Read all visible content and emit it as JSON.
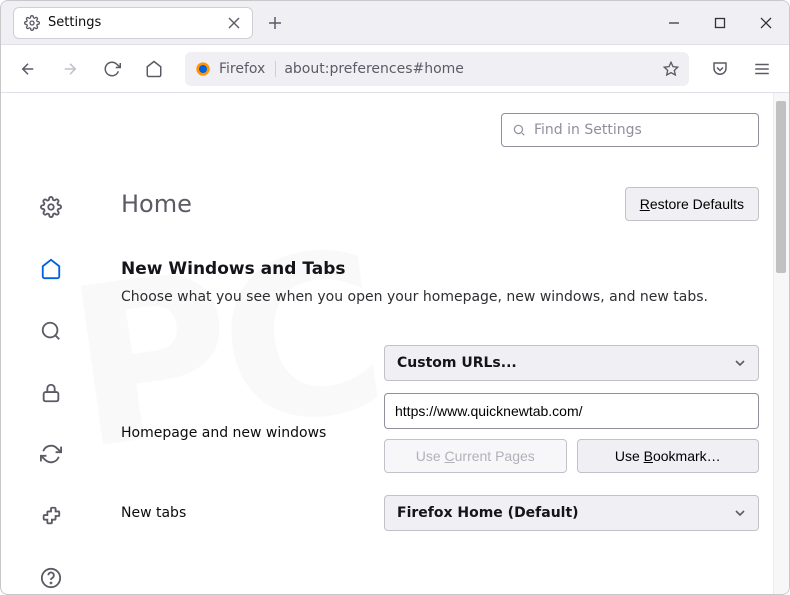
{
  "tab": {
    "title": "Settings"
  },
  "url": {
    "identity": "Firefox",
    "value": "about:preferences#home"
  },
  "search": {
    "placeholder": "Find in Settings"
  },
  "sidebar": {
    "items": [
      {
        "name": "general",
        "active": false
      },
      {
        "name": "home",
        "active": true
      },
      {
        "name": "search",
        "active": false
      },
      {
        "name": "privacy",
        "active": false
      },
      {
        "name": "sync",
        "active": false
      },
      {
        "name": "extensions",
        "active": false
      },
      {
        "name": "support",
        "active": false
      }
    ]
  },
  "page": {
    "heading": "Home",
    "restore_defaults": "Restore Defaults",
    "section_title": "New Windows and Tabs",
    "section_desc": "Choose what you see when you open your homepage, new windows, and new tabs.",
    "homepage_label": "Homepage and new windows",
    "homepage_select": "Custom URLs...",
    "homepage_url": "https://www.quicknewtab.com/",
    "use_current": "Use Current Pages",
    "use_bookmark": "Use Bookmark…",
    "newtabs_label": "New tabs",
    "newtabs_select": "Firefox Home (Default)"
  }
}
